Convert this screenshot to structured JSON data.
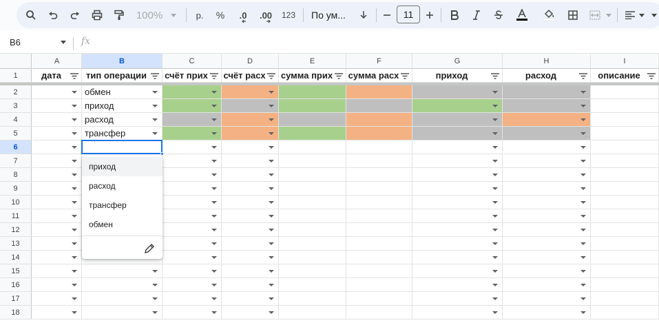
{
  "toolbar": {
    "zoom": "100%",
    "currency": "р.",
    "percent": "%",
    "decimal_decrease": ".0",
    "decimal_increase": ".00",
    "number_format": "123",
    "font_name": "По ум...",
    "font_size": "11",
    "icons": [
      "search-icon",
      "undo-icon",
      "redo-icon",
      "print-icon",
      "paint-format-icon",
      "minus-icon",
      "plus-icon",
      "bold-icon",
      "italic-icon",
      "strikethrough-icon",
      "text-color-icon",
      "fill-color-icon",
      "borders-icon",
      "merge-icon",
      "align-icon"
    ],
    "colors": {
      "text_color_bar": "#000000",
      "fill_color_bar": "#ffffff"
    }
  },
  "formula_bar": {
    "cell_ref": "B6",
    "fx": "fx",
    "value": ""
  },
  "columns": [
    "A",
    "B",
    "C",
    "D",
    "E",
    "F",
    "G",
    "H",
    "I"
  ],
  "header_row": [
    "дата",
    "тип операции",
    "счёт прих",
    "счёт расх",
    "сумма прих",
    "сумма расх",
    "приход",
    "расход",
    "описание"
  ],
  "rows": [
    "1",
    "2",
    "3",
    "4",
    "5",
    "6",
    "7",
    "8",
    "9",
    "10",
    "11",
    "12",
    "13",
    "14",
    "15",
    "16",
    "17",
    "18"
  ],
  "data_rows": [
    {
      "B": "обмен",
      "fills": {
        "C": "green",
        "D": "orange",
        "E": "green",
        "F": "orange",
        "G": "gray",
        "H": "gray"
      }
    },
    {
      "B": "приход",
      "fills": {
        "C": "green",
        "D": "gray",
        "E": "green",
        "F": "gray",
        "G": "green",
        "H": "gray"
      }
    },
    {
      "B": "расход",
      "fills": {
        "C": "gray",
        "D": "orange",
        "E": "gray",
        "F": "orange",
        "G": "gray",
        "H": "orange"
      }
    },
    {
      "B": "трансфер",
      "fills": {
        "C": "green",
        "D": "orange",
        "E": "green",
        "F": "orange",
        "G": "gray",
        "H": "gray"
      }
    }
  ],
  "active_cell": "B6",
  "dropdown_menu": {
    "options": [
      "приход",
      "расход",
      "трансфер",
      "обмен"
    ],
    "highlighted": "приход"
  },
  "colors": {
    "green": "#a8d08d",
    "orange": "#f4b183",
    "gray": "#bfbfbf",
    "selection": "#1a73e8"
  }
}
